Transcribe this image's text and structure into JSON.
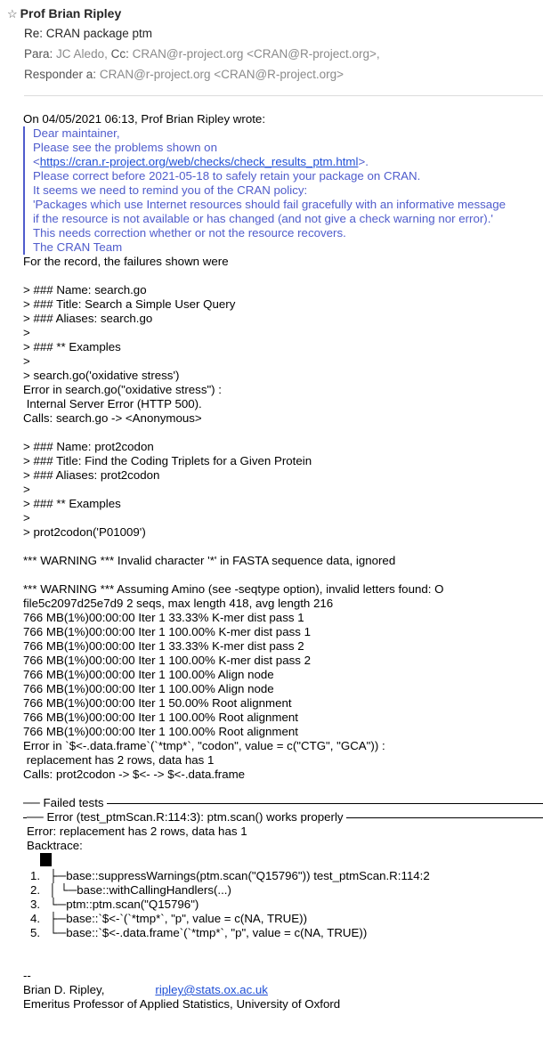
{
  "header": {
    "star_icon": "☆",
    "from": "Prof Brian Ripley",
    "subject": "Re: CRAN package ptm",
    "to_label": "Para:",
    "to_value": "JC Aledo,",
    "cc_label": "Cc:",
    "cc_value": "CRAN@r-project.org <CRAN@R-project.org>,",
    "reply_label": "Responder a:",
    "reply_value": "CRAN@r-project.org <CRAN@R-project.org>"
  },
  "body": {
    "intro": "On 04/05/2021 06:13, Prof Brian Ripley wrote:",
    "quote": {
      "l1": "Dear maintainer,",
      "l2": "Please see the problems shown on",
      "l3_pre": "<",
      "l3_link": "https://cran.r-project.org/web/checks/check_results_ptm.html",
      "l3_post": ">.",
      "l4": "Please correct before 2021-05-18 to safely retain your package on CRAN.",
      "l5": "It seems we need to remind you of the CRAN policy:",
      "l6": "'Packages which use Internet resources should fail gracefully with an informative message",
      "l7": "if the resource is not available or has changed (and not give a check warning nor error).'",
      "l8": "This needs correction whether or not the resource recovers.",
      "l9": "The CRAN Team"
    },
    "record": "For the record, the failures shown were",
    "log": [
      "> ### Name: search.go",
      "> ### Title: Search a Simple User Query",
      "> ### Aliases: search.go",
      ">",
      "> ### ** Examples",
      ">",
      "> search.go('oxidative stress')",
      "Error in search.go(\"oxidative stress\") :",
      " Internal Server Error (HTTP 500).",
      "Calls: search.go -> <Anonymous>",
      "",
      "> ### Name: prot2codon",
      "> ### Title: Find the Coding Triplets for a Given Protein",
      "> ### Aliases: prot2codon",
      ">",
      "> ### ** Examples",
      ">",
      "> prot2codon('P01009')",
      "",
      "*** WARNING *** Invalid character '*' in FASTA sequence data, ignored",
      "",
      "*** WARNING *** Assuming Amino (see -seqtype option), invalid letters found: O",
      "file5c2097d25e7d9 2 seqs, max length 418, avg length 216",
      "766 MB(1%)00:00:00 Iter 1 33.33% K-mer dist pass 1",
      "766 MB(1%)00:00:00 Iter 1 100.00% K-mer dist pass 1",
      "766 MB(1%)00:00:00 Iter 1 33.33% K-mer dist pass 2",
      "766 MB(1%)00:00:00 Iter 1 100.00% K-mer dist pass 2",
      "766 MB(1%)00:00:00 Iter 1 100.00% Align node",
      "766 MB(1%)00:00:00 Iter 1 100.00% Align node",
      "766 MB(1%)00:00:00 Iter 1 50.00% Root alignment",
      "766 MB(1%)00:00:00 Iter 1 100.00% Root alignment",
      "766 MB(1%)00:00:00 Iter 1 100.00% Root alignment",
      "Error in `$<-.data.frame`(`*tmp*`, \"codon\", value = c(\"CTG\", \"GCA\")) :",
      " replacement has 2 rows, data has 1",
      "Calls: prot2codon -> $<- -> $<-.data.frame"
    ],
    "failed_tests": "Failed tests",
    "error_heading": "Error (test_ptmScan.R:114:3): ptm.scan() works properly",
    "error_line": "Error: replacement has 2 rows, data has 1",
    "backtrace": "Backtrace:",
    "trace": [
      {
        "n": "1.",
        "t": "├─base::suppressWarnings(ptm.scan(\"Q15796\")) test_ptmScan.R:114:2"
      },
      {
        "n": "2.",
        "t": "│ └─base::withCallingHandlers(...)"
      },
      {
        "n": "3.",
        "t": "└─ptm::ptm.scan(\"Q15796\")"
      },
      {
        "n": "4.",
        "t": "├─base::`$<-`(`*tmp*`, \"p\", value = c(NA, TRUE))"
      },
      {
        "n": "5.",
        "t": "└─base::`$<-.data.frame`(`*tmp*`, \"p\", value = c(NA, TRUE))"
      }
    ]
  },
  "signature": {
    "dashes": "--",
    "name": "Brian D. Ripley,",
    "email": "ripley@stats.ox.ac.uk",
    "title": "Emeritus Professor of Applied Statistics, University of Oxford"
  }
}
